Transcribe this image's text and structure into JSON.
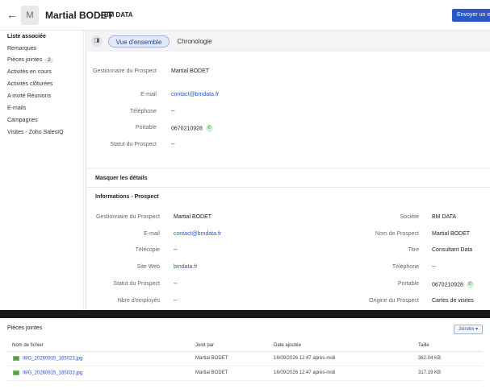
{
  "header": {
    "back_icon": "arrow-left-icon",
    "avatar_initial": "M",
    "record_name": "Martial BODET",
    "record_company": "- BM DATA",
    "send_button": "Envoyer un e"
  },
  "sidebar": {
    "title": "Liste associée",
    "items": [
      {
        "label": "Remarques"
      },
      {
        "label": "Pièces jointes",
        "count": "2"
      },
      {
        "label": "Activités en cours"
      },
      {
        "label": "Activités clôturées"
      },
      {
        "label": "A invité Réunions"
      },
      {
        "label": "E-mails"
      },
      {
        "label": "Campagnes"
      },
      {
        "label": "Visites - Zoho SalesIQ"
      }
    ]
  },
  "tabs": {
    "toggle_icon": "panel-toggle-icon",
    "overview": "Vue d'ensemble",
    "timeline": "Chronologie"
  },
  "overview": {
    "fields": [
      {
        "label": "Gestionnaire du Prospect",
        "value": "Martial BODET"
      },
      {
        "label": "E-mail",
        "value": "contact@bmdata.fr"
      },
      {
        "label": "Téléphone",
        "value": "--"
      },
      {
        "label": "Portable",
        "value": "0670210928"
      },
      {
        "label": "Statut du Prospect",
        "value": "--"
      }
    ]
  },
  "details": {
    "hide_label": "Masquer les détails",
    "section_title": "Informations - Prospect",
    "left": [
      {
        "label": "Gestionnaire du Prospect",
        "value": "Martial BODET"
      },
      {
        "label": "E-mail",
        "value": "contact@bmdata.fr"
      },
      {
        "label": "Télécopie",
        "value": "--"
      },
      {
        "label": "Site Web",
        "value": "bmdata.fr"
      },
      {
        "label": "Statut du Prospect",
        "value": "--"
      },
      {
        "label": "Nbre d'employés",
        "value": "--"
      }
    ],
    "right": [
      {
        "label": "Société",
        "value": "BM DATA"
      },
      {
        "label": "Nom de Prospect",
        "value": "Martial BODET"
      },
      {
        "label": "Titre",
        "value": "Consultant Data"
      },
      {
        "label": "Téléphone",
        "value": "--"
      },
      {
        "label": "Portable",
        "value": "0670210928"
      },
      {
        "label": "Origine du Prospect",
        "value": "Cartes de visites"
      }
    ]
  },
  "attachments": {
    "title": "Pièces jointes",
    "attach_button": "Joindre ▾",
    "columns": [
      "Nom de fichier",
      "Joint par",
      "Date ajoutée",
      "Taille"
    ],
    "rows": [
      [
        "IMG_20260915_165023.jpg",
        "Martial BODET",
        "16/09/2026 12:47 après-midi",
        "362.04 KB"
      ],
      [
        "IMG_20260915_165033.jpg",
        "Martial BODET",
        "16/09/2026 12:47 après-midi",
        "317.19 KB"
      ]
    ]
  },
  "colors": {
    "accent": "#2b56c5",
    "phone_green": "#2e9a3a"
  }
}
